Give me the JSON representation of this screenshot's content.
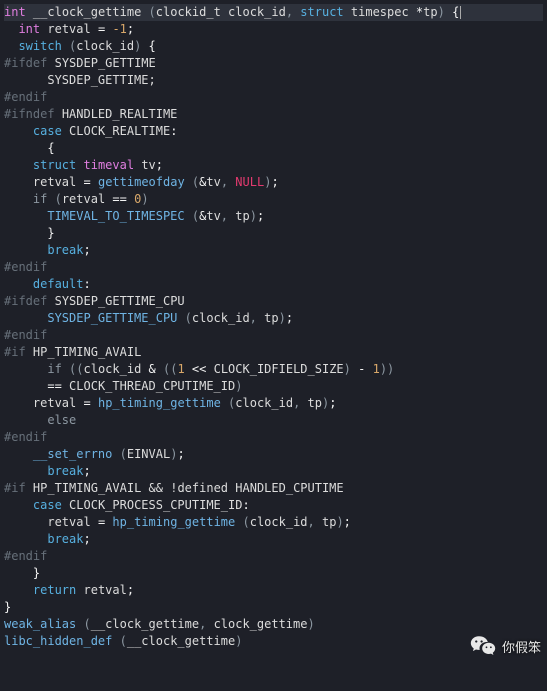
{
  "overlay": {
    "text": "你假笨"
  },
  "tokens": {
    "int": "int",
    "struct": "struct",
    "timeval": "timeval",
    "timespec": "timespec",
    "clockid_t": "clockid_t",
    "NULL": "NULL",
    "switch": "switch",
    "case": "case",
    "default": "default",
    "break": "break",
    "return": "return",
    "if": "if",
    "else": "else",
    "pp_ifdef": "#ifdef",
    "pp_ifndef": "#ifndef",
    "pp_if": "#if",
    "pp_endif": "#endif",
    "fn_clock_gettime": "__clock_gettime",
    "fn_gettimeofday": "gettimeofday",
    "fn_timeval_to_timespec": "TIMEVAL_TO_TIMESPEC",
    "fn_sysdep_gettime_cpu": "SYSDEP_GETTIME_CPU",
    "fn_hp_timing_gettime": "hp_timing_gettime",
    "fn_set_errno": "__set_errno",
    "fn_weak_alias": "weak_alias",
    "fn_libc_hidden_def": "libc_hidden_def",
    "id_clock_id": "clock_id",
    "id_tp": "tp",
    "id_retval": "retval",
    "id_tv": "tv",
    "id_EINVAL": "EINVAL",
    "id_clock_gettime": "clock_gettime",
    "c_SYSDEP_GETTIME": "SYSDEP_GETTIME",
    "c_SYSDEP_GETTIME2": "SYSDEP_GETTIME;",
    "c_HANDLED_REALTIME": "HANDLED_REALTIME",
    "c_CLOCK_REALTIME": "CLOCK_REALTIME",
    "c_SYSDEP_GETTIME_CPU": "SYSDEP_GETTIME_CPU",
    "c_HP_TIMING_AVAIL": "HP_TIMING_AVAIL",
    "c_CLOCK_IDFIELD_SIZE": "CLOCK_IDFIELD_SIZE",
    "c_CLOCK_THREAD_CPUTIME_ID": "CLOCK_THREAD_CPUTIME_ID",
    "c_HANDLED_CPUTIME": "HANDLED_CPUTIME",
    "c_CLOCK_PROCESS_CPUTIME_ID": "CLOCK_PROCESS_CPUTIME_ID",
    "defined": "defined",
    "n_neg1": "-1",
    "n_0": "0",
    "n_1a": "1",
    "n_1b": "1",
    "op_eqeq": "==",
    "op_eq1": "=",
    "op_eq2": "=",
    "op_eq3": "=",
    "op_eq4": "=",
    "op_star": "*",
    "op_amp": "&",
    "op_shl": "<<",
    "op_and": "&&",
    "op_not": "!"
  }
}
